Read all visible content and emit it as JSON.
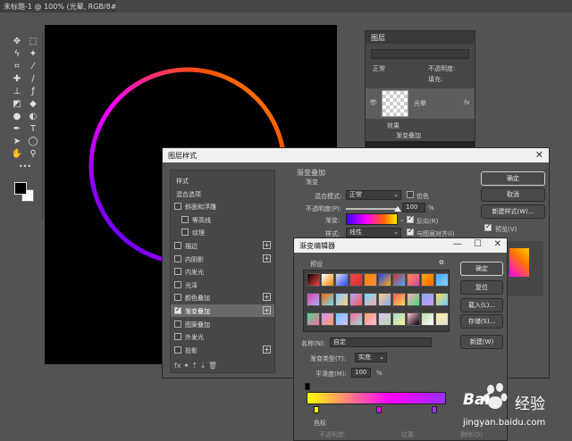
{
  "doc_tab": {
    "title": "未标题-1 @ 100% (光晕, RGB/8#) *",
    "close": "×"
  },
  "tools": [
    {
      "icon": "move-icon",
      "glyph": "✥"
    },
    {
      "icon": "marquee-icon",
      "glyph": "⬚"
    },
    {
      "icon": "lasso-icon",
      "glyph": "ϟ"
    },
    {
      "icon": "magic-wand-icon",
      "glyph": "✦"
    },
    {
      "icon": "crop-icon",
      "glyph": "⌗"
    },
    {
      "icon": "eyedropper-icon",
      "glyph": "⁄"
    },
    {
      "icon": "healing-icon",
      "glyph": "✚"
    },
    {
      "icon": "brush-icon",
      "glyph": "∕"
    },
    {
      "icon": "stamp-icon",
      "glyph": "⊥"
    },
    {
      "icon": "history-brush-icon",
      "glyph": "ƒ"
    },
    {
      "icon": "eraser-icon",
      "glyph": "◩"
    },
    {
      "icon": "paint-bucket-icon",
      "glyph": "◆"
    },
    {
      "icon": "blur-icon",
      "glyph": "●"
    },
    {
      "icon": "dodge-icon",
      "glyph": "◐"
    },
    {
      "icon": "pen-icon",
      "glyph": "✒"
    },
    {
      "icon": "type-icon",
      "glyph": "T"
    },
    {
      "icon": "path-select-icon",
      "glyph": "➤"
    },
    {
      "icon": "shape-icon",
      "glyph": "◯"
    },
    {
      "icon": "hand-icon",
      "glyph": "✋"
    },
    {
      "icon": "zoom-icon",
      "glyph": "⚲"
    },
    {
      "icon": "more-icon",
      "glyph": "•••"
    }
  ],
  "layers_panel": {
    "title": "图层",
    "mode_label": "正常",
    "opacity_label": "不透明度:",
    "fill_label": "填充:",
    "layer_name": "光晕",
    "fx_label": "fx",
    "effects_label": "效果",
    "effect_item": "渐变叠加"
  },
  "layer_style": {
    "title": "图层样式",
    "close": "✕",
    "list": [
      {
        "label": "样式",
        "checkbox": false,
        "plus": false,
        "checked": false,
        "selected": false
      },
      {
        "label": "混合选项",
        "checkbox": false,
        "plus": false,
        "checked": false,
        "selected": false
      },
      {
        "label": "斜面和浮雕",
        "checkbox": true,
        "plus": false,
        "checked": false,
        "selected": false
      },
      {
        "label": "等高线",
        "checkbox": true,
        "plus": false,
        "checked": false,
        "selected": false,
        "indent": true
      },
      {
        "label": "纹理",
        "checkbox": true,
        "plus": false,
        "checked": false,
        "selected": false,
        "indent": true
      },
      {
        "label": "描边",
        "checkbox": true,
        "plus": true,
        "checked": false,
        "selected": false
      },
      {
        "label": "内阴影",
        "checkbox": true,
        "plus": true,
        "checked": false,
        "selected": false
      },
      {
        "label": "内发光",
        "checkbox": true,
        "plus": false,
        "checked": false,
        "selected": false
      },
      {
        "label": "光泽",
        "checkbox": true,
        "plus": false,
        "checked": false,
        "selected": false
      },
      {
        "label": "颜色叠加",
        "checkbox": true,
        "plus": true,
        "checked": false,
        "selected": false
      },
      {
        "label": "渐变叠加",
        "checkbox": true,
        "plus": true,
        "checked": true,
        "selected": true
      },
      {
        "label": "图案叠加",
        "checkbox": true,
        "plus": false,
        "checked": false,
        "selected": false
      },
      {
        "label": "外发光",
        "checkbox": true,
        "plus": false,
        "checked": false,
        "selected": false
      },
      {
        "label": "投影",
        "checkbox": true,
        "plus": true,
        "checked": false,
        "selected": false
      }
    ],
    "footer": "fx  ✦  ⇡  ⇣        🗑",
    "section_title": "渐变叠加",
    "subsection": "渐变",
    "blend_mode_label": "混合模式:",
    "blend_mode_value": "正常",
    "dither_label": "仿色",
    "opacity_label": "不透明度(P):",
    "opacity_value": "100",
    "percent": "%",
    "gradient_label": "渐变:",
    "reverse_label": "反向(R)",
    "style_label": "样式:",
    "style_value": "线性",
    "align_label": "与图层对齐(I)",
    "ok": "确定",
    "cancel": "取消",
    "new_style": "新建样式(W)...",
    "preview_label": "预览(V)"
  },
  "gradient_editor": {
    "title": "渐变编辑器",
    "min": "—",
    "max": "☐",
    "close": "✕",
    "presets_label": "预设",
    "gear": "✿.",
    "ok": "确定",
    "reset": "复位",
    "load": "载入(L)...",
    "save": "存储(S)...",
    "name_label": "名称(N):",
    "name_value": "自定",
    "new_btn": "新建(W)",
    "type_label": "渐变类型(T):",
    "type_value": "实底",
    "smooth_label": "平滑度(M):",
    "smooth_value": "100",
    "percent": "%",
    "stops_section": "色标",
    "stop_opacity_label": "不透明度:",
    "stop_position_label": "位置:",
    "delete_label": "删除(D)"
  },
  "preset_colors": [
    "#000000",
    "#ffffff",
    "#e0e0e0",
    "#ff4444",
    "#ff8800",
    "#2244ff",
    "#cc3333",
    "#ff8844",
    "#ffaa00",
    "#44aaff",
    "#dd44aa",
    "#ff6600",
    "#88ccff",
    "#aaaaff",
    "#66ddff",
    "#ffcc88",
    "#ff5555",
    "#ffaaaa",
    "#88aaee",
    "#ffdd55",
    "#44dd88",
    "#cc99ff",
    "#66ccff",
    "#ff66aa",
    "#ff9966",
    "#ddbbff",
    "#99ddcc",
    "#ffbbdd",
    "#bbddaa",
    "#ffee99"
  ],
  "watermark": {
    "brand": "Bai",
    "brand2": "经验",
    "url": "jingyan.baidu.com"
  }
}
